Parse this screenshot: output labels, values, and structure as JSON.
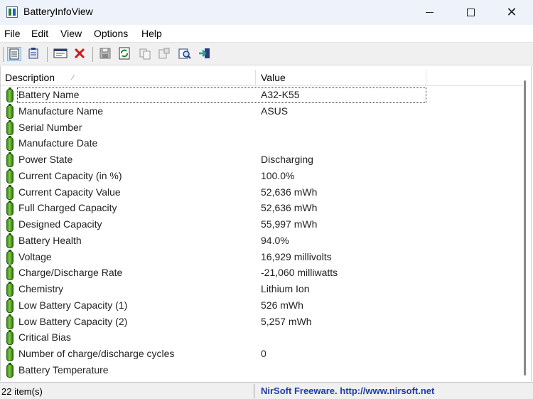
{
  "window": {
    "title": "BatteryInfoView"
  },
  "menu": [
    "File",
    "Edit",
    "View",
    "Options",
    "Help"
  ],
  "toolbar": {
    "icons": [
      "html-report-icon",
      "text-report-icon",
      "properties-icon",
      "delete-icon",
      "save-icon",
      "refresh-icon",
      "copy-icon",
      "options-icon",
      "find-icon",
      "exit-icon"
    ]
  },
  "columns": {
    "description": "Description",
    "value": "Value"
  },
  "rows": [
    {
      "desc": "Battery Name",
      "value": "A32-K55"
    },
    {
      "desc": "Manufacture Name",
      "value": "ASUS"
    },
    {
      "desc": "Serial Number",
      "value": ""
    },
    {
      "desc": "Manufacture Date",
      "value": ""
    },
    {
      "desc": "Power State",
      "value": "Discharging"
    },
    {
      "desc": "Current Capacity (in %)",
      "value": "100.0%"
    },
    {
      "desc": "Current Capacity Value",
      "value": "52,636 mWh"
    },
    {
      "desc": "Full Charged Capacity",
      "value": "52,636 mWh"
    },
    {
      "desc": "Designed Capacity",
      "value": "55,997 mWh"
    },
    {
      "desc": "Battery Health",
      "value": "94.0%"
    },
    {
      "desc": "Voltage",
      "value": "16,929 millivolts"
    },
    {
      "desc": "Charge/Discharge Rate",
      "value": "-21,060 milliwatts"
    },
    {
      "desc": "Chemistry",
      "value": "Lithium Ion"
    },
    {
      "desc": "Low Battery Capacity (1)",
      "value": "526 mWh"
    },
    {
      "desc": "Low Battery Capacity (2)",
      "value": "5,257 mWh"
    },
    {
      "desc": "Critical Bias",
      "value": ""
    },
    {
      "desc": "Number of charge/discharge cycles",
      "value": "0"
    },
    {
      "desc": "Battery Temperature",
      "value": ""
    }
  ],
  "status": {
    "count": "22 item(s)",
    "link": "NirSoft Freeware.  http://www.nirsoft.net"
  },
  "colors": {
    "link": "#1f3aa6",
    "battery_icon": "#4caf1f"
  }
}
